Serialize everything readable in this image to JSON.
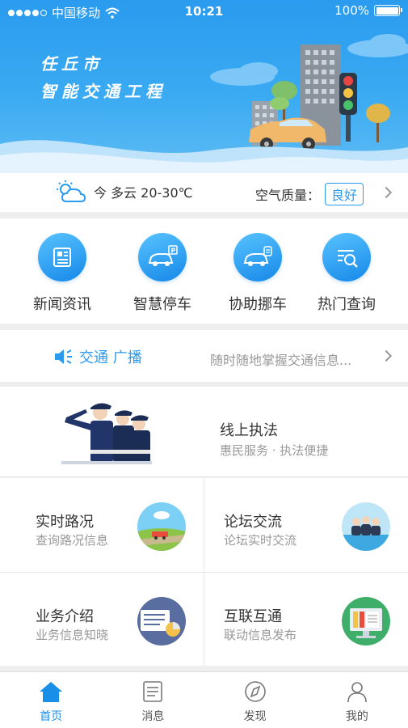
{
  "status_bar": {
    "carrier": "中国移动",
    "time": "10:21",
    "battery": "100%"
  },
  "banner": {
    "line1": "任丘市",
    "line2": "智能交通工程"
  },
  "weather": {
    "icon": "partly-cloudy-icon",
    "text": "今 多云 20-30℃",
    "aq_label": "空气质量：",
    "aq_value": "良好"
  },
  "features": [
    {
      "label": "新闻资讯",
      "icon": "newspaper-icon"
    },
    {
      "label": "智慧停车",
      "icon": "parking-car-icon"
    },
    {
      "label": "协助挪车",
      "icon": "move-car-icon"
    },
    {
      "label": "热门查询",
      "icon": "search-list-icon"
    }
  ],
  "broadcast": {
    "icon": "speaker-icon",
    "label": "交通 广播",
    "text": "随时随地掌握交通信息..."
  },
  "law": {
    "title": "线上执法",
    "subtitle": "惠民服务 · 执法便捷"
  },
  "tiles": [
    {
      "title": "实时路况",
      "subtitle": "查询路况信息"
    },
    {
      "title": "论坛交流",
      "subtitle": "论坛实时交流"
    },
    {
      "title": "业务介绍",
      "subtitle": "业务信息知晓"
    },
    {
      "title": "互联互通",
      "subtitle": "联动信息发布"
    }
  ],
  "tabs": [
    {
      "label": "首页",
      "icon": "home-icon",
      "active": true
    },
    {
      "label": "消息",
      "icon": "message-icon"
    },
    {
      "label": "发现",
      "icon": "compass-icon"
    },
    {
      "label": "我的",
      "icon": "user-icon"
    }
  ],
  "colors": {
    "primary": "#2a9bee",
    "active_tab": "#1a8fe8"
  }
}
